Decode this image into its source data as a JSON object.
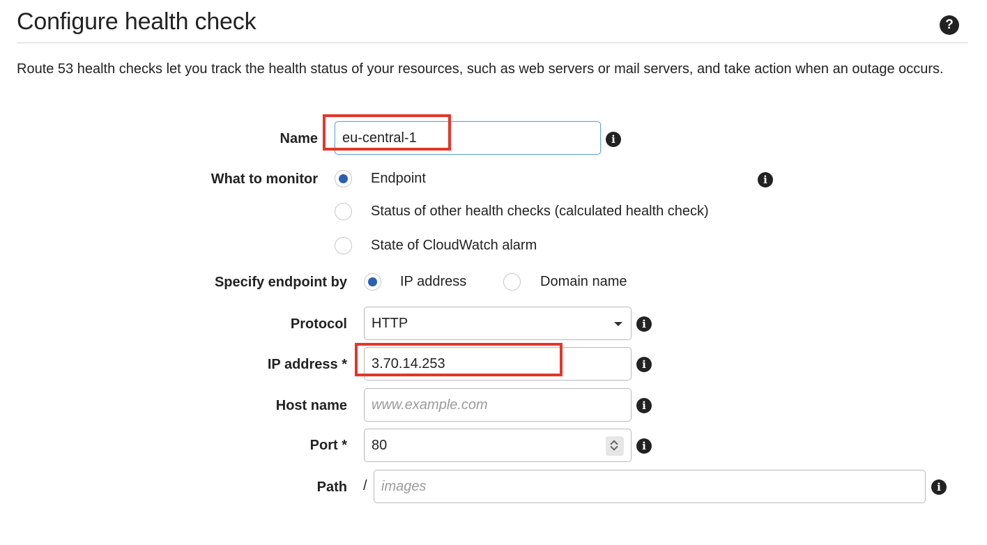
{
  "header": {
    "title": "Configure health check",
    "help_icon": "question-circle-icon"
  },
  "description": "Route 53 health checks let you track the health status of your resources, such as web servers or mail servers, and take action when an outage occurs.",
  "form": {
    "name": {
      "label": "Name",
      "value": "eu-central-1"
    },
    "what_to_monitor": {
      "label": "What to monitor",
      "options": [
        {
          "label": "Endpoint",
          "checked": true
        },
        {
          "label": "Status of other health checks (calculated health check)",
          "checked": false
        },
        {
          "label": "State of CloudWatch alarm",
          "checked": false
        }
      ]
    },
    "specify_endpoint_by": {
      "label": "Specify endpoint by",
      "options": [
        {
          "label": "IP address",
          "checked": true
        },
        {
          "label": "Domain name",
          "checked": false
        }
      ]
    },
    "protocol": {
      "label": "Protocol",
      "value": "HTTP"
    },
    "ip_address": {
      "label": "IP address *",
      "value": "3.70.14.253"
    },
    "host_name": {
      "label": "Host name",
      "value": "",
      "placeholder": "www.example.com"
    },
    "port": {
      "label": "Port *",
      "value": "80"
    },
    "path": {
      "label": "Path",
      "prefix": "/",
      "value": "",
      "placeholder": "images"
    }
  },
  "colors": {
    "radio_checked": "#2b5fb3",
    "highlight": "#e2372a",
    "focus_border": "#6aa5d8"
  }
}
